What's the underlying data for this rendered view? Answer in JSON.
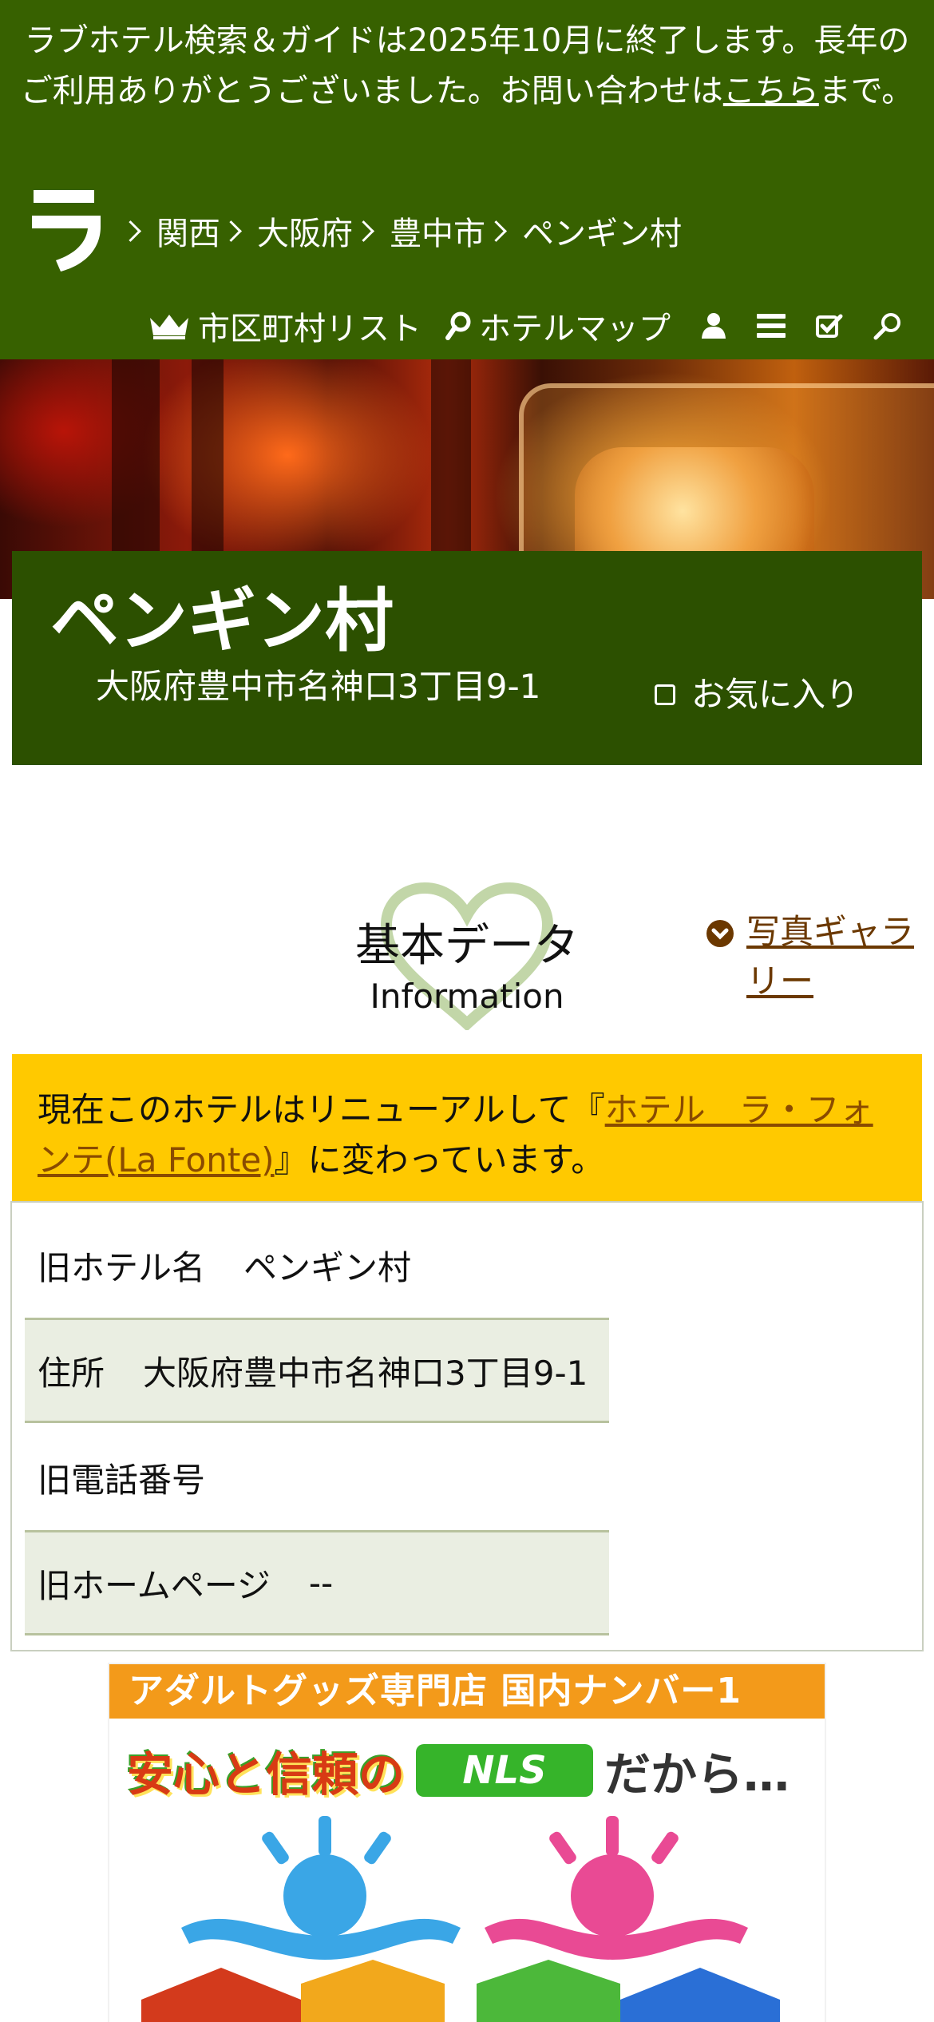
{
  "notice": {
    "text": "ラブホテル検索＆ガイドは2025年10月に終了します。長年のご利用ありがとうございました。お問い合わせは",
    "link": "こちら",
    "suffix": "まで。"
  },
  "site": {
    "logo_text": "ラ"
  },
  "breadcrumb": [
    "関西",
    "大阪府",
    "豊中市",
    "ペンギン村"
  ],
  "nav": {
    "city_list": "市区町村リスト",
    "hotel_map": "ホテルマップ",
    "icons": [
      "user-icon",
      "menu-icon",
      "checklist-icon",
      "search-icon"
    ]
  },
  "hotel": {
    "name": "ペンギン村",
    "address": "大阪府豊中市名神口3丁目9-1",
    "favorite_label": "お気に入り"
  },
  "section": {
    "title": "基本データ",
    "subtitle": "Information",
    "gallery_link": "写真ギャラリー"
  },
  "renewal": {
    "prefix": "現在このホテルはリニューアルして『",
    "link": "ホテル　ラ・フォンテ(La Fonte)",
    "suffix": "』に変わっています。"
  },
  "info_rows": [
    {
      "label": "旧ホテル名",
      "value": "ペンギン村"
    },
    {
      "label": "住所",
      "value": "大阪府豊中市名神口3丁目9-1"
    },
    {
      "label": "旧電話番号",
      "value": ""
    },
    {
      "label": "旧ホームページ",
      "value": "--"
    }
  ],
  "ad": {
    "header": "アダルトグッズ専門店 国内ナンバー1",
    "line_a": "安心と信頼の",
    "brand": "NLS",
    "line_b": "だから…"
  },
  "colors": {
    "header_bg": "#376100",
    "title_bg": "#2c5000",
    "renewal_bg": "#ffc900",
    "row_alt_bg": "#eaeee2",
    "link_brown": "#6b3800"
  }
}
